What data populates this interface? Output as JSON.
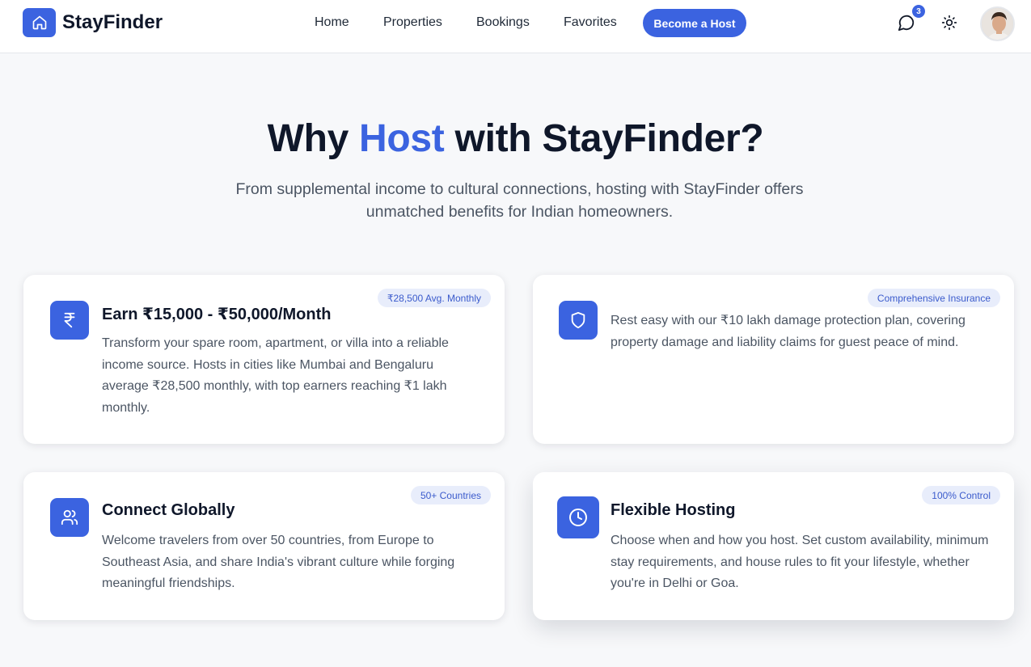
{
  "header": {
    "brand": "StayFinder",
    "nav": {
      "home": "Home",
      "properties": "Properties",
      "bookings": "Bookings",
      "favorites": "Favorites"
    },
    "host_button": "Become a Host",
    "message_count": "3"
  },
  "hero": {
    "title_before": "Why ",
    "title_accent": "Host",
    "title_after": " with StayFinder?",
    "subtitle": "From supplemental income to cultural connections, hosting with StayFinder offers unmatched benefits for Indian homeowners."
  },
  "cards": {
    "earn": {
      "badge": "₹28,500 Avg. Monthly",
      "title": "Earn ₹15,000 - ₹50,000/Month",
      "text": "Transform your spare room, apartment, or villa into a reliable income source. Hosts in cities like Mumbai and Bengaluru average ₹28,500 monthly, with top earners reaching ₹1 lakh monthly.",
      "icon": "rupee-icon"
    },
    "insurance": {
      "badge": "Comprehensive Insurance",
      "title": "",
      "text": "Rest easy with our ₹10 lakh damage protection plan, covering property damage and liability claims for guest peace of mind.",
      "icon": "shield-icon"
    },
    "connect": {
      "badge": "50+ Countries",
      "title": "Connect Globally",
      "text": "Welcome travelers from over 50 countries, from Europe to Southeast Asia, and share India's vibrant culture while forging meaningful friendships.",
      "icon": "users-icon"
    },
    "flexible": {
      "badge": "100% Control",
      "title": "Flexible Hosting",
      "text": "Choose when and how you host. Set custom availability, minimum stay requirements, and house rules to fit your lifestyle, whether you're in Delhi or Goa.",
      "icon": "clock-icon"
    }
  },
  "colors": {
    "accent": "#3b63e0",
    "pill_bg": "#e8edfb",
    "page_bg": "#f7f8fa"
  }
}
